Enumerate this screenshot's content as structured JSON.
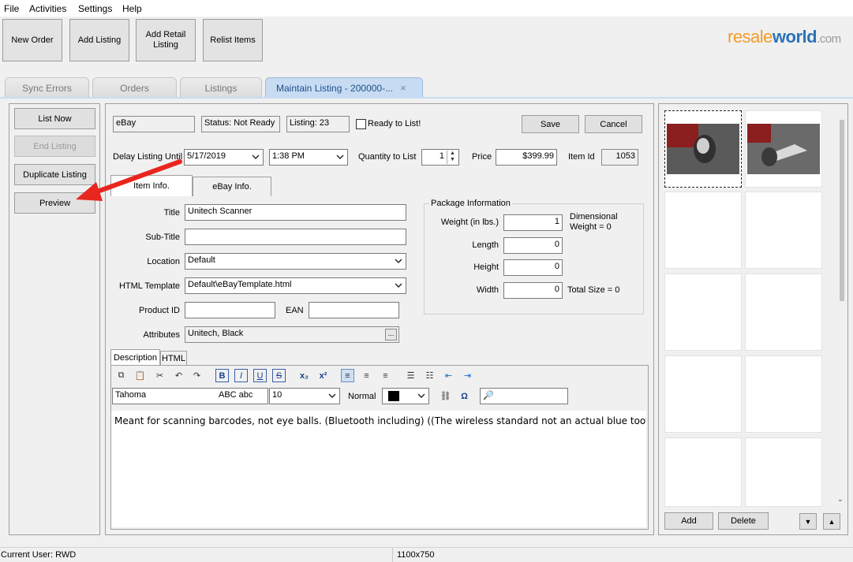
{
  "menu": [
    "File",
    "Activities",
    "Settings",
    "Help"
  ],
  "toolbar": {
    "new_order": "New Order",
    "add_listing": "Add Listing",
    "add_retail_listing": "Add Retail Listing",
    "relist_items": "Relist Items"
  },
  "logo": {
    "part1": "resale",
    "part2": "world",
    ".com": ".com"
  },
  "tabs": [
    "Sync Errors",
    "Orders",
    "Listings",
    "Maintain Listing - 200000-..."
  ],
  "tab_close": "×",
  "sidebar": {
    "list_now": "List Now",
    "end_listing": "End Listing",
    "duplicate_listing": "Duplicate Listing",
    "preview": "Preview"
  },
  "header": {
    "marketplace": "eBay",
    "status": "Status: Not Ready",
    "listing": "Listing: 23",
    "ready_label": "Ready to List!",
    "save": "Save",
    "cancel": "Cancel"
  },
  "row2": {
    "delay_label": "Delay Listing Until",
    "delay_date": "5/17/2019",
    "delay_time": "1:38 PM",
    "qty_label": "Quantity to List",
    "qty_value": "1",
    "price_label": "Price",
    "price_value": "$399.99",
    "item_id_label": "Item Id",
    "item_id_value": "1053"
  },
  "inner_tabs": [
    "Item Info.",
    "eBay Info."
  ],
  "form": {
    "title_label": "Title",
    "title_value": "Unitech Scanner",
    "subtitle_label": "Sub-Title",
    "subtitle_value": "",
    "location_label": "Location",
    "location_value": "Default",
    "template_label": "HTML Template",
    "template_value": "Default\\eBayTemplate.html",
    "product_id_label": "Product ID",
    "product_id_value": "",
    "ean_label": "EAN",
    "ean_value": "",
    "attributes_label": "Attributes",
    "attributes_value": "Unitech, Black",
    "attributes_button": "..."
  },
  "package": {
    "legend": "Package Information",
    "weight_label": "Weight (in lbs.)",
    "weight_value": "1",
    "dimensional": "Dimensional Weight = 0",
    "length_label": "Length",
    "length_value": "0",
    "height_label": "Height",
    "height_value": "0",
    "width_label": "Width",
    "width_value": "0",
    "total_size": "Total Size = 0"
  },
  "editor": {
    "tabs": [
      "Description",
      "HTML"
    ],
    "font": "Tahoma",
    "font_preview": "ABC abc",
    "size": "10",
    "style": "Normal",
    "content": "Meant for scanning barcodes, not eye balls. (Bluetooth including) ((The wireless standard not an actual blue tooth))"
  },
  "images": {
    "add": "Add",
    "delete": "Delete"
  },
  "statusbar": {
    "user": "Current User: RWD",
    "resolution": "1100x750"
  },
  "colors": {
    "active_tab": "#c7dcf3",
    "arrow": "#e8261f",
    "logo_orange": "#f39c27",
    "logo_blue": "#2b73b8"
  }
}
